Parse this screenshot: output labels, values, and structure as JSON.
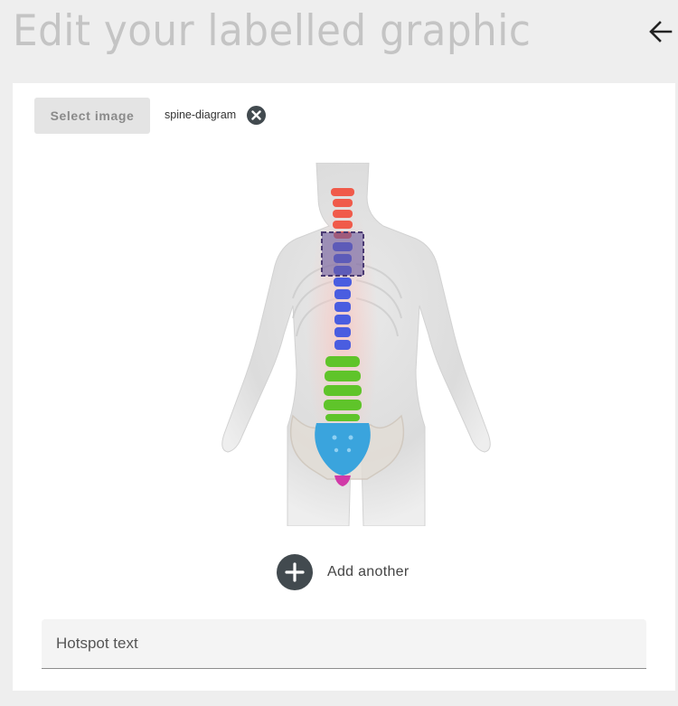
{
  "header": {
    "title": "Edit your labelled graphic",
    "back_icon": "arrow-left-icon"
  },
  "image_picker": {
    "select_label": "Select image",
    "filename": "spine-diagram",
    "remove_icon": "close-circle-icon"
  },
  "figure": {
    "subject": "human back with spine segments",
    "segment_colors": {
      "cervical": "#f05a4a",
      "thoracic": "#4a5de0",
      "lumbar": "#5fc42a",
      "sacrum": "#3aa4dd",
      "coccyx": "#d13aa8"
    },
    "hotspot": {
      "fill": "#6a5a9c",
      "border": "#4a3a72"
    }
  },
  "actions": {
    "add_label": "Add another",
    "add_icon": "plus-circle-icon"
  },
  "hotspot_field": {
    "placeholder": "Hotspot text",
    "value": ""
  }
}
